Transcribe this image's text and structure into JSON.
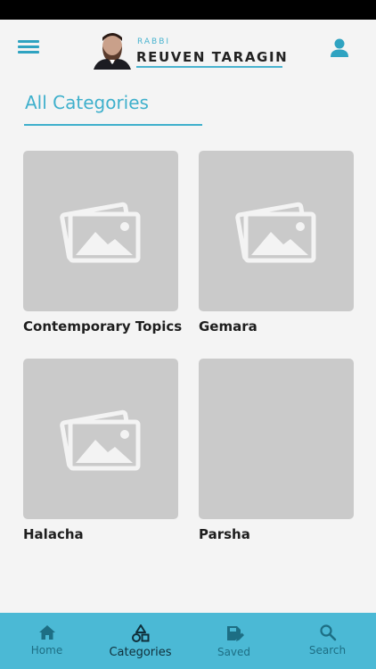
{
  "header": {
    "logo_small": "RABBI",
    "logo_big": "REUVEN TARAGIN"
  },
  "page": {
    "title": "All Categories"
  },
  "categories": [
    {
      "label": "Contemporary Topics",
      "placeholder_icon": "image-placeholder-icon"
    },
    {
      "label": "Gemara",
      "placeholder_icon": "image-placeholder-icon"
    },
    {
      "label": "Halacha",
      "placeholder_icon": "image-placeholder-icon"
    },
    {
      "label": "Parsha",
      "placeholder_icon": ""
    }
  ],
  "tabs": [
    {
      "label": "Home",
      "icon": "home-icon"
    },
    {
      "label": "Categories",
      "icon": "categories-icon",
      "active": true
    },
    {
      "label": "Saved",
      "icon": "saved-icon"
    },
    {
      "label": "Search",
      "icon": "search-icon"
    }
  ],
  "colors": {
    "accent": "#3fb0cc",
    "tabbar": "#4bb9d5",
    "placeholder": "#cacaca"
  }
}
